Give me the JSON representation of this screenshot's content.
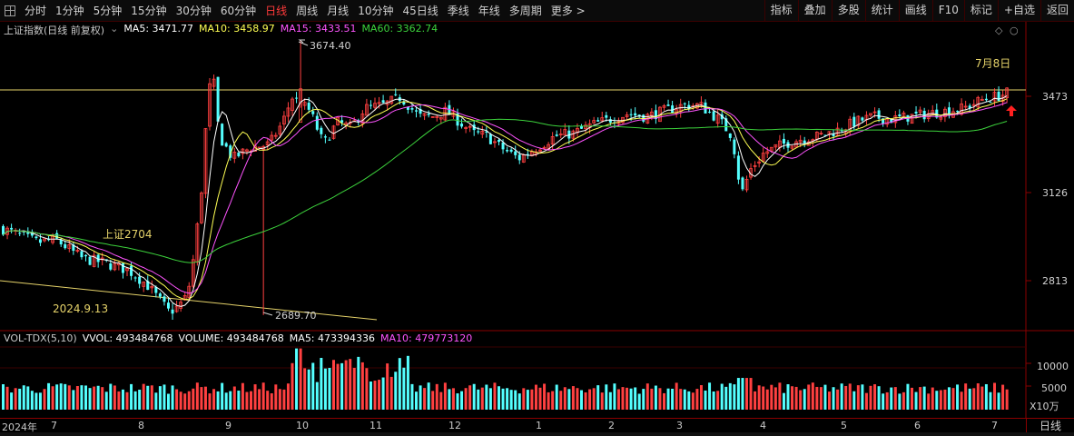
{
  "toolbar": {
    "left_items": [
      {
        "label": "分时",
        "active": false
      },
      {
        "label": "1分钟",
        "active": false
      },
      {
        "label": "5分钟",
        "active": false
      },
      {
        "label": "15分钟",
        "active": false
      },
      {
        "label": "30分钟",
        "active": false
      },
      {
        "label": "60分钟",
        "active": false
      },
      {
        "label": "日线",
        "active": true
      },
      {
        "label": "周线",
        "active": false
      },
      {
        "label": "月线",
        "active": false
      },
      {
        "label": "10分钟",
        "active": false
      },
      {
        "label": "45日线",
        "active": false
      },
      {
        "label": "季线",
        "active": false
      },
      {
        "label": "年线",
        "active": false
      },
      {
        "label": "多周期",
        "active": false
      },
      {
        "label": "更多 >",
        "active": false
      }
    ],
    "right_items": [
      "指标",
      "叠加",
      "多股",
      "统计",
      "画线",
      "F10",
      "标记",
      "+自选",
      "返回"
    ]
  },
  "main_legend": {
    "title": "上证指数(日线 前复权)",
    "ma5": "MA5: 3471.77",
    "ma10": "MA10: 3458.97",
    "ma15": "MA15: 3433.51",
    "ma60": "MA60: 3362.74"
  },
  "vol_legend": {
    "title": "VOL-TDX(5,10)",
    "vvol": "VVOL: 493484768",
    "volume": "VOLUME: 493484768",
    "ma5": "MA5: 473394336",
    "ma10": "MA10: 479773120"
  },
  "colors": {
    "up": "#ff4040",
    "down": "#54ffff",
    "ma5": "#ffffff",
    "ma10": "#ffff54",
    "ma15": "#ff54ff",
    "ma60": "#3cd23c",
    "axis": "#8a0000",
    "label_yellow": "#e6d36a"
  },
  "annotations": {
    "high": "3674.40",
    "low": "2689.70",
    "date_low": "2024.9.13",
    "date_right": "7月8日",
    "note": "上证2704"
  },
  "price_axis": {
    "ticks": [
      "3473",
      "3126",
      "2813"
    ]
  },
  "vol_axis": {
    "ticks": [
      "10000",
      "5000"
    ],
    "unit": "X10万"
  },
  "x_axis": {
    "year": "2024年",
    "months": [
      "7",
      "8",
      "9",
      "10",
      "11",
      "12",
      "1",
      "2",
      "3",
      "4",
      "5",
      "6",
      "7"
    ]
  },
  "period_button": "日线",
  "chart_data": {
    "type": "candlestick",
    "title": "上证指数(日线 前复权)",
    "x_range": [
      "2024-07",
      "2025-07-08"
    ],
    "y_range": [
      2680,
      3700
    ],
    "key_points": [
      {
        "label": "low",
        "date": "2024-09-13",
        "value": 2689.7
      },
      {
        "label": "high",
        "date": "2024-10-08",
        "value": 3674.4
      },
      {
        "label": "last",
        "date": "2025-07-08",
        "value": 3473
      }
    ],
    "last_ma": {
      "MA5": 3471.77,
      "MA10": 3458.97,
      "MA15": 3433.51,
      "MA60": 3362.74
    },
    "last_volume": {
      "VOLUME": 493484768,
      "MA5": 473394336,
      "MA10": 479773120
    }
  }
}
